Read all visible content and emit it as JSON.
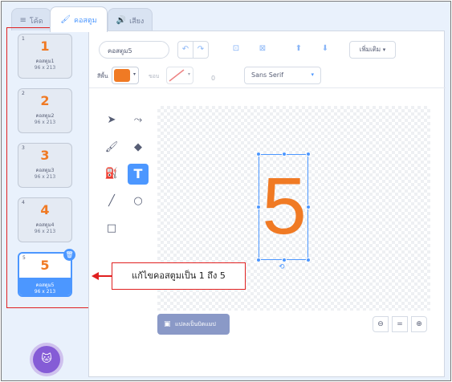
{
  "tabs": [
    {
      "label": "โค้ด",
      "icon": "code-icon"
    },
    {
      "label": "คอสตูม",
      "icon": "brush-icon"
    },
    {
      "label": "เสียง",
      "icon": "speaker-icon"
    }
  ],
  "costumes": [
    {
      "index": "1",
      "big": "1",
      "name": "คอสตูม1",
      "size": "96 x 213"
    },
    {
      "index": "2",
      "big": "2",
      "name": "คอสตูม2",
      "size": "96 x 213"
    },
    {
      "index": "3",
      "big": "3",
      "name": "คอสตูม3",
      "size": "96 x 213"
    },
    {
      "index": "4",
      "big": "4",
      "name": "คอสตูม4",
      "size": "96 x 213"
    },
    {
      "index": "5",
      "big": "5",
      "name": "คอสตูม5",
      "size": "96 x 213"
    }
  ],
  "editor": {
    "costume_name": "คอสตูม5",
    "more_label": "เพิ่มเติม",
    "fill_label": "สีพื้น",
    "outline_label": "ขอบ",
    "outline_width": "0",
    "font": "Sans Serif",
    "canvas_text": "5",
    "convert_button": "แปลงเป็นบิตแมป",
    "zoom_reset": "="
  },
  "annotation": {
    "text": "แก้ไขคอสตูมเป็น 1 ถึง 5"
  },
  "colors": {
    "accent": "#4c97ff",
    "fill_color": "#f07a24",
    "annotation": "#e02020"
  }
}
